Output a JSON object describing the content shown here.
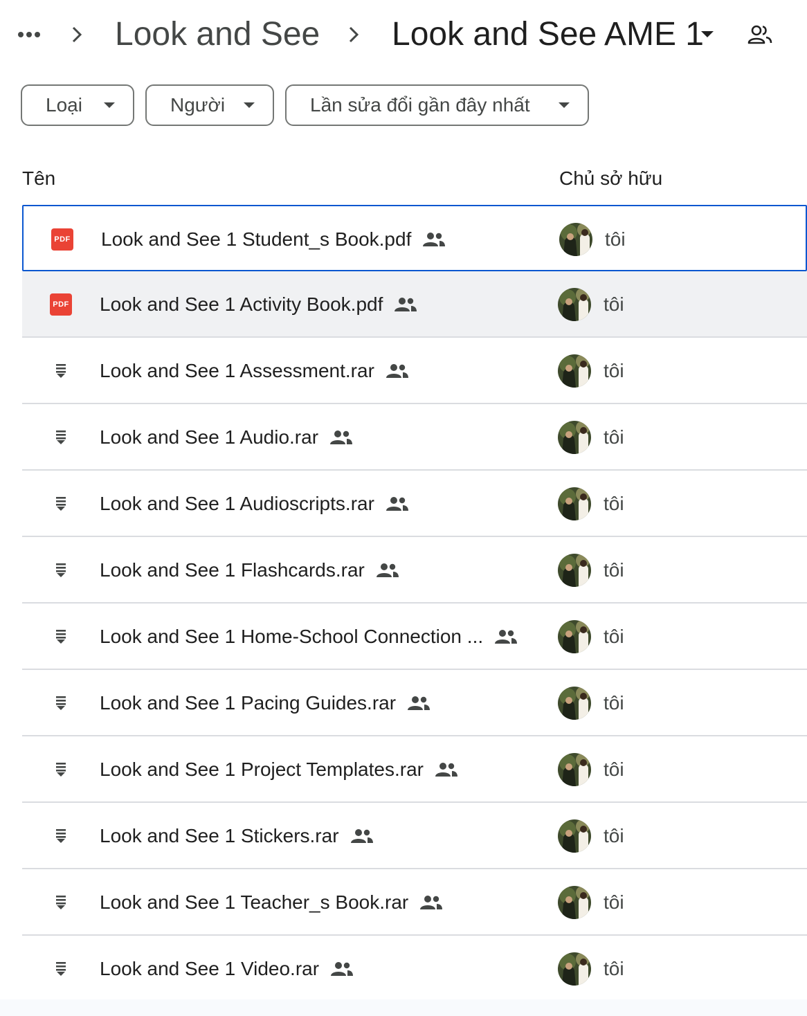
{
  "breadcrumb": {
    "parent": "Look and See",
    "current": "Look and See AME 1"
  },
  "filters": [
    {
      "label": "Loại"
    },
    {
      "label": "Người"
    },
    {
      "label": "Lần sửa đổi gần đây nhất"
    }
  ],
  "columns": {
    "name": "Tên",
    "owner": "Chủ sở hữu"
  },
  "files": [
    {
      "name": "Look and See 1 Student_s Book.pdf",
      "type": "pdf",
      "owner": "tôi"
    },
    {
      "name": "Look and See 1 Activity Book.pdf",
      "type": "pdf",
      "owner": "tôi"
    },
    {
      "name": "Look and See 1 Assessment.rar",
      "type": "archive",
      "owner": "tôi"
    },
    {
      "name": "Look and See 1 Audio.rar",
      "type": "archive",
      "owner": "tôi"
    },
    {
      "name": "Look and See 1 Audioscripts.rar",
      "type": "archive",
      "owner": "tôi"
    },
    {
      "name": "Look and See 1 Flashcards.rar",
      "type": "archive",
      "owner": "tôi"
    },
    {
      "name": "Look and See 1 Home-School Connection ...",
      "type": "archive",
      "owner": "tôi"
    },
    {
      "name": "Look and See 1 Pacing Guides.rar",
      "type": "archive",
      "owner": "tôi"
    },
    {
      "name": "Look and See 1 Project Templates.rar",
      "type": "archive",
      "owner": "tôi"
    },
    {
      "name": "Look and See 1 Stickers.rar",
      "type": "archive",
      "owner": "tôi"
    },
    {
      "name": "Look and See 1 Teacher_s Book.rar",
      "type": "archive",
      "owner": "tôi"
    },
    {
      "name": "Look and See 1 Video.rar",
      "type": "archive",
      "owner": "tôi"
    }
  ],
  "pdf_badge": "PDF",
  "colors": {
    "accent": "#0b57d0",
    "pdf": "#ea4335",
    "hover_row": "#f0f1f3",
    "divider": "#dadce0"
  }
}
